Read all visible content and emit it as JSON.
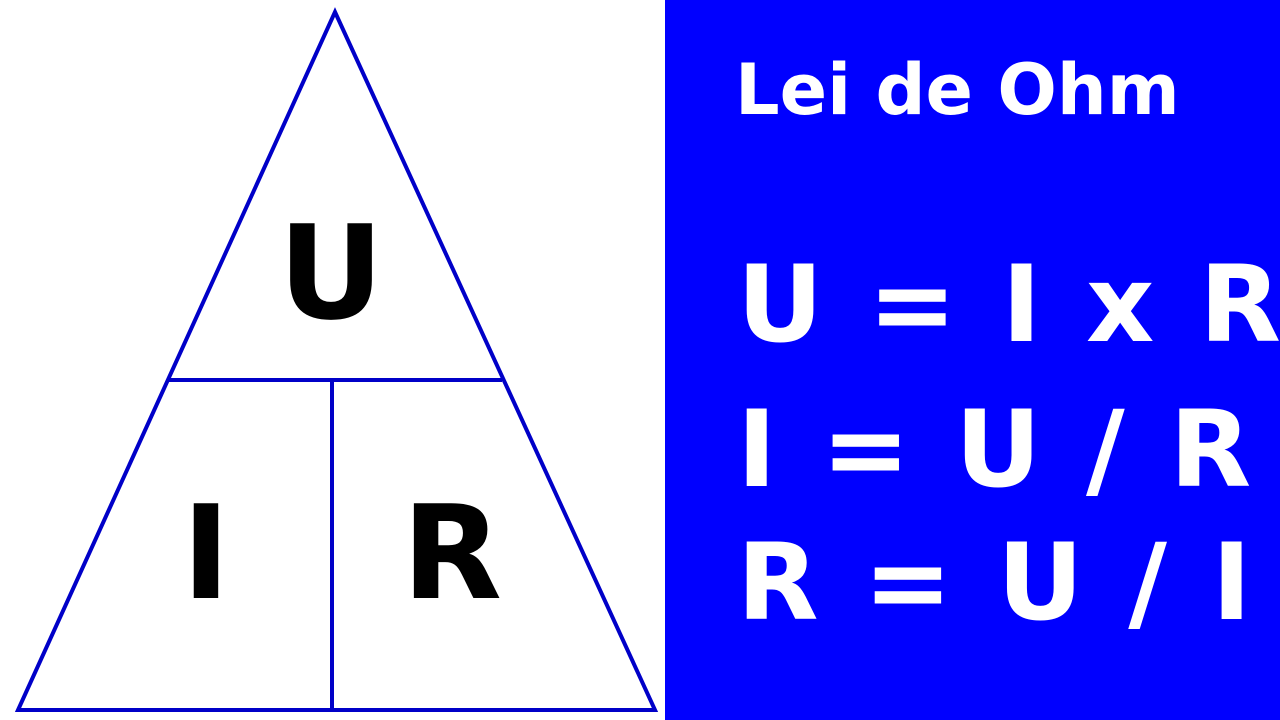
{
  "triangle": {
    "top_label": "U",
    "bottom_left_label": "I",
    "bottom_right_label": "R",
    "stroke_color": "#0000c8"
  },
  "panel": {
    "title": "Lei de Ohm",
    "background_color": "#0000ff",
    "text_color": "#ffffff",
    "formulas": [
      "U = I x R",
      "I = U / R",
      "R = U / I"
    ]
  }
}
